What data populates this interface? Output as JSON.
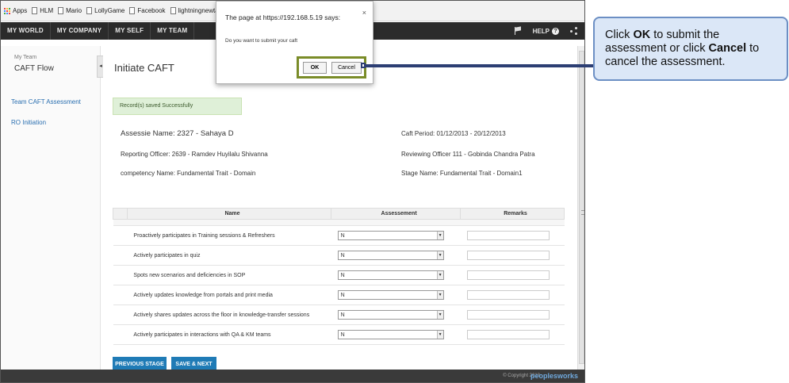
{
  "bookmarks": [
    {
      "label": "Apps",
      "icon": "apps-icon"
    },
    {
      "label": "HLM",
      "icon": "document-icon"
    },
    {
      "label": "Mario",
      "icon": "document-icon"
    },
    {
      "label": "LollyGame",
      "icon": "document-icon"
    },
    {
      "label": "Facebook",
      "icon": "document-icon"
    },
    {
      "label": "lightningnewtab",
      "icon": "document-icon"
    }
  ],
  "nav": {
    "items": [
      "MY WORLD",
      "MY COMPANY",
      "MY SELF",
      "MY TEAM"
    ],
    "help_label": "HELP",
    "help_icon_glyph": "?"
  },
  "sidebar": {
    "section": "My Team",
    "title": "CAFT Flow",
    "collapse_glyph": "◂",
    "links": [
      "Team CAFT Assessment",
      "RO Initiation"
    ]
  },
  "main": {
    "title": "Initiate CAFT",
    "success_message": "Record(s) saved Successfully",
    "assessee": "Assessie Name: 2327 - Sahaya D",
    "reporting_officer": "Reporting Officer: 2639 - Ramdev Huyilalu Shivanna",
    "competency": "competency Name: Fundamental Trait - Domain",
    "caft_period": "Caft Period: 01/12/2013 - 20/12/2013",
    "reviewing_officer": "Reviewing Officer 111 - Gobinda Chandra Patra",
    "stage_name": "Stage Name: Fundamental Trait - Domain1"
  },
  "table": {
    "headers": [
      "Name",
      "Assessement",
      "Remarks"
    ],
    "rows": [
      {
        "name": "Proactively participates in Training sessions & Refreshers",
        "value": "N"
      },
      {
        "name": "Actively participates in quiz",
        "value": "N"
      },
      {
        "name": "Spots new scenarios and deficiencies in SOP",
        "value": "N"
      },
      {
        "name": "Actively updates knowledge from portals and print media",
        "value": "N"
      },
      {
        "name": "Actively shares updates across the floor in knowledge-transfer sessions",
        "value": "N"
      },
      {
        "name": "Actively participates in interactions with QA & KM teams",
        "value": "N"
      }
    ]
  },
  "buttons": {
    "previous": "PREVIOUS STAGE",
    "save_next": "SAVE & NEXT"
  },
  "footer": {
    "copyright": "© Copyright 2013",
    "logo": "peoplesworks"
  },
  "dialog": {
    "title": "The page at https://192.168.5.19 says:",
    "close_glyph": "×",
    "message": "Do you want to submit your caft",
    "ok": "OK",
    "cancel": "Cancel"
  },
  "callout": {
    "pre": "Click ",
    "ok_bold": "OK",
    "mid": " to submit the assessment or click ",
    "cancel_bold": "Cancel",
    "post": " to cancel the assessment."
  },
  "colors": {
    "nav_bg": "#2b2b2b",
    "link": "#2a6fb0",
    "button_blue": "#1f7bb6",
    "success_bg": "#dff0d8",
    "callout_bg": "#dbe7f7",
    "callout_border": "#6c8fc4",
    "highlight_border": "#7a8c28"
  }
}
